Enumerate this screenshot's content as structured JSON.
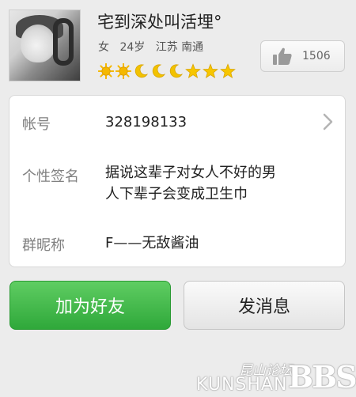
{
  "profile": {
    "name": "宅到深处叫活埋°",
    "gender": "女",
    "age": "24岁",
    "location": "江苏 南通",
    "badges": [
      "sun",
      "sun",
      "moon",
      "moon",
      "moon",
      "star",
      "star",
      "star"
    ],
    "like_count": "1506"
  },
  "details": {
    "account_label": "帐号",
    "account_value": "328198133",
    "signature_label": "个性签名",
    "signature_line1": "据说这辈子对女人不好的男",
    "signature_line2": "人下辈子会变成卫生巾",
    "group_nick_label": "群昵称",
    "group_nick_value": "F——无敌酱油"
  },
  "actions": {
    "add_friend": "加为好友",
    "send_message": "发消息"
  },
  "watermark": {
    "cn": "昆山论坛",
    "en": "KUNSHAN",
    "bbs": "BBS"
  },
  "colors": {
    "primary_green": "#3cb548",
    "sun": "#f5b800",
    "moon": "#f2c200",
    "star": "#f7c600"
  }
}
